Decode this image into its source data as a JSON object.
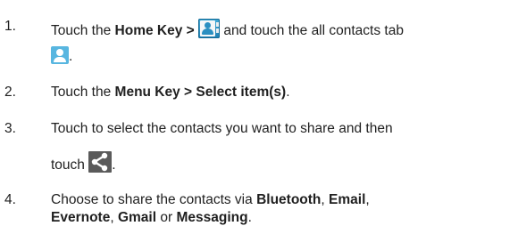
{
  "steps": [
    {
      "number": "1.",
      "line1": {
        "t1": "Touch the ",
        "b1": "Home Key > ",
        "t2": " and touch the all contacts tab"
      },
      "line2": {
        "t1": "."
      }
    },
    {
      "number": "2.",
      "line1": {
        "t1": "Touch the ",
        "b1": "Menu Key > Select item(s)",
        "t2": "."
      }
    },
    {
      "number": "3.",
      "line1": {
        "t1": "Touch to select the contacts you want to share and then"
      },
      "line2": {
        "t1": "touch ",
        "t2": "."
      }
    },
    {
      "number": "4.",
      "line1": {
        "t1": "Choose to share the contacts via ",
        "b1": "Bluetooth",
        "t2": ", ",
        "b2": "Email",
        "t3": ","
      },
      "line2": {
        "b1": "Evernote",
        "t1": ", ",
        "b2": "Gmail",
        "t2": " or ",
        "b3": "Messaging",
        "t3": "."
      }
    }
  ],
  "icons": {
    "people_app": "contacts-app-icon",
    "all_contacts_tab": "person-icon",
    "share": "share-icon"
  }
}
